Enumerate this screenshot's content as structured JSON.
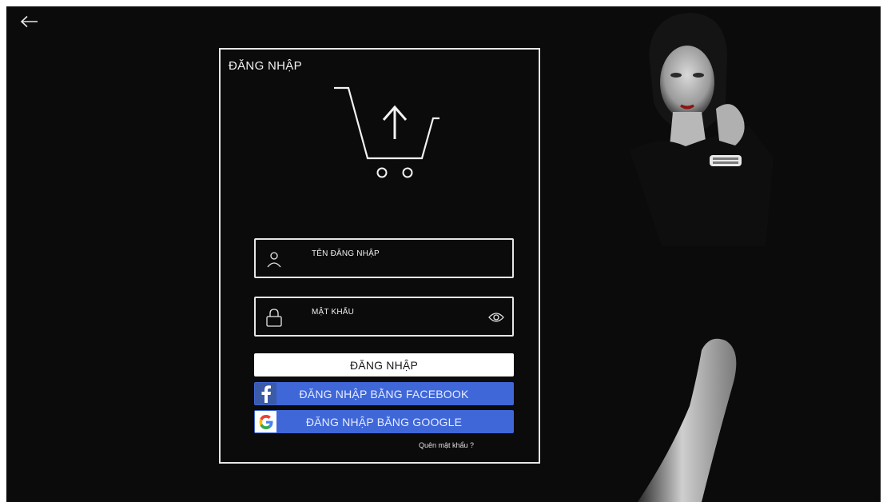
{
  "login_card": {
    "title": "ĐĂNG NHẬP",
    "username_placeholder": "TÊN ĐĂNG NHẬP",
    "password_placeholder": "MẬT KHẨU",
    "login_button": "ĐĂNG NHẬP",
    "facebook_button": "ĐĂNG NHẬP BẰNG FACEBOOK",
    "google_button": "ĐĂNG NHẬP BẰNG GOOGLE",
    "forgot_password": "Quên mật khẩu ?"
  },
  "icons": {
    "back": "arrow-left-icon",
    "logo": "cart-upload-icon",
    "username": "user-icon",
    "password": "lock-icon",
    "show_password": "eye-icon",
    "facebook": "facebook-icon",
    "google": "google-icon"
  },
  "colors": {
    "background": "#0b0b0b",
    "card_border": "#e6e6e6",
    "primary_button": "#ffffff",
    "social_button": "#3f67d8",
    "facebook_badge": "#3b5aa8"
  }
}
